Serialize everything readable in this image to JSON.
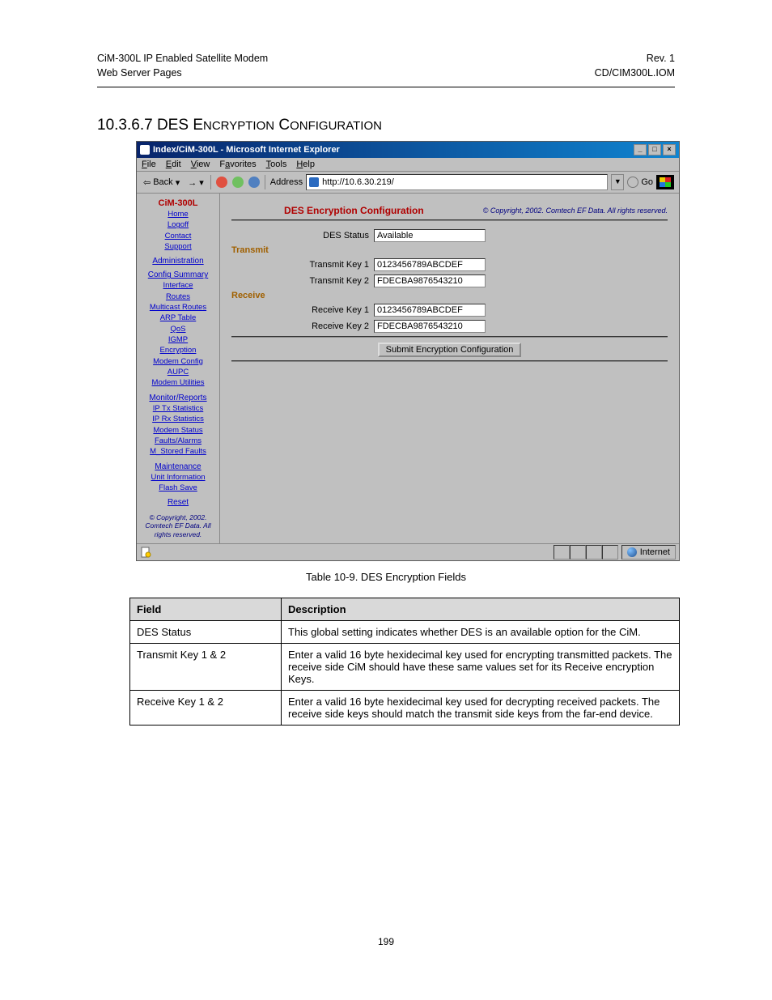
{
  "header": {
    "left_line1": "CiM-300L IP Enabled Satellite Modem",
    "left_line2": "Web Server Pages",
    "right_line1": "Rev. 1",
    "right_line2": "CD/CIM300L.IOM"
  },
  "section": {
    "number": "10.3.6.7",
    "title_word1": "DES",
    "title_word2_caps": "E",
    "title_word2_rest": "NCRYPTION",
    "title_word3_caps": "C",
    "title_word3_rest": "ONFIGURATION"
  },
  "browser": {
    "title": "Index/CiM-300L - Microsoft Internet Explorer",
    "menus": [
      "File",
      "Edit",
      "View",
      "Favorites",
      "Tools",
      "Help"
    ],
    "back_label": "Back",
    "address_label": "Address",
    "address_value": "http://10.6.30.219/",
    "go_label": "Go",
    "status_zone": "Internet"
  },
  "nav": {
    "product": "CiM-300L",
    "top_links": [
      "Home",
      "Logoff",
      "Contact",
      "Support"
    ],
    "admin_head": "Administration",
    "config_head": "Config Summary",
    "config_links": [
      "Interface",
      "Routes",
      "Multicast Routes",
      "ARP Table",
      "QoS",
      "IGMP",
      "Encryption",
      "Modem Config",
      "AUPC",
      "Modem Utilities"
    ],
    "monitor_head": "Monitor/Reports",
    "monitor_links": [
      "IP Tx Statistics",
      "IP Rx Statistics",
      "Modem Status",
      "Faults/Alarms",
      "M_Stored Faults"
    ],
    "maint_head": "Maintenance",
    "maint_links": [
      "Unit Information",
      "Flash Save"
    ],
    "reset": "Reset",
    "copyright": "© Copyright, 2002. Comtech EF Data. All rights reserved."
  },
  "pane": {
    "title": "DES Encryption Configuration",
    "copyright": "© Copyright, 2002. Comtech EF Data. All rights reserved.",
    "des_status_label": "DES Status",
    "des_status_value": "Available",
    "transmit_head": "Transmit",
    "tx1_label": "Transmit Key 1",
    "tx1_value": "0123456789ABCDEF",
    "tx2_label": "Transmit Key 2",
    "tx2_value": "FDECBA9876543210",
    "receive_head": "Receive",
    "rx1_label": "Receive Key 1",
    "rx1_value": "0123456789ABCDEF",
    "rx2_label": "Receive Key 2",
    "rx2_value": "FDECBA9876543210",
    "submit": "Submit Encryption Configuration"
  },
  "table": {
    "caption": "Table 10-9.  DES Encryption Fields",
    "head_field": "Field",
    "head_desc": "Description",
    "rows": [
      {
        "field": "DES Status",
        "desc": "This global setting indicates whether DES is an available option for the CiM."
      },
      {
        "field": "Transmit Key 1 & 2",
        "desc": "Enter a valid 16 byte hexidecimal key used for encrypting transmitted packets.  The receive side CiM should have these same values set for its Receive encryption Keys."
      },
      {
        "field": "Receive Key 1 & 2",
        "desc": "Enter a valid 16 byte hexidecimal key used for decrypting received packets.  The receive side keys should match the transmit side keys from the far-end device."
      }
    ]
  },
  "page_number": "199"
}
